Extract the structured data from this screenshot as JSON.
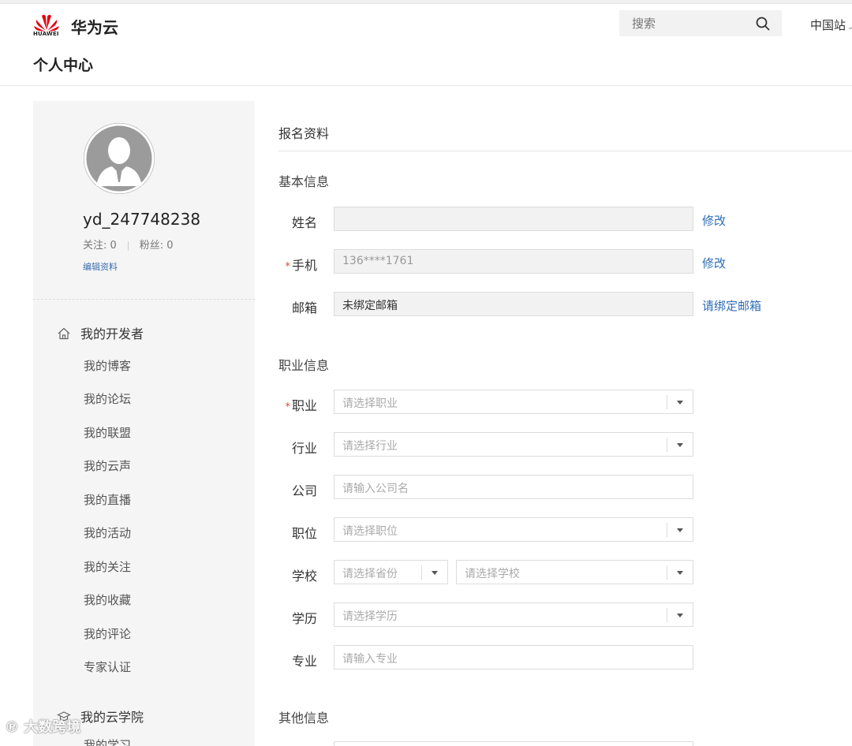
{
  "header": {
    "logo_text": "HUAWEI",
    "brand": "华为云",
    "search_placeholder": "搜索",
    "region": "中国站",
    "page_title": "个人中心"
  },
  "profile": {
    "username": "yd_247748238",
    "follow_label": "关注: 0",
    "fans_label": "粉丝: 0",
    "edit_link": "编辑资料"
  },
  "sidebar": {
    "developer_section": "我的开发者",
    "developer_items": [
      "我的博客",
      "我的论坛",
      "我的联盟",
      "我的云声",
      "我的直播",
      "我的活动",
      "我的关注",
      "我的收藏",
      "我的评论",
      "专家认证"
    ],
    "academy_section": "我的云学院",
    "academy_partial_item": "我的学习"
  },
  "main": {
    "title": "报名资料",
    "basic_title": "基本信息",
    "career_title": "职业信息",
    "other_title": "其他信息",
    "name_label": "姓名",
    "name_value": "",
    "name_action": "修改",
    "phone_label": "手机",
    "phone_value": "136****1761",
    "phone_action": "修改",
    "email_label": "邮箱",
    "email_value": "未绑定邮箱",
    "email_action": "请绑定邮箱",
    "occupation_label": "职业",
    "occupation_placeholder": "请选择职业",
    "industry_label": "行业",
    "industry_placeholder": "请选择行业",
    "company_label": "公司",
    "company_placeholder": "请输入公司名",
    "position_label": "职位",
    "position_placeholder": "请选择职位",
    "school_label": "学校",
    "province_placeholder": "请选择省份",
    "school_placeholder": "请选择学校",
    "education_label": "学历",
    "education_placeholder": "请选择学历",
    "major_label": "专业",
    "major_placeholder": "请输入专业",
    "required_mark": "*"
  },
  "watermark": "大数跨境",
  "colors": {
    "link": "#2f6db5",
    "required": "#e8463a",
    "brand_red": "#e60012",
    "sidebar_bg": "#f5f5f5"
  }
}
